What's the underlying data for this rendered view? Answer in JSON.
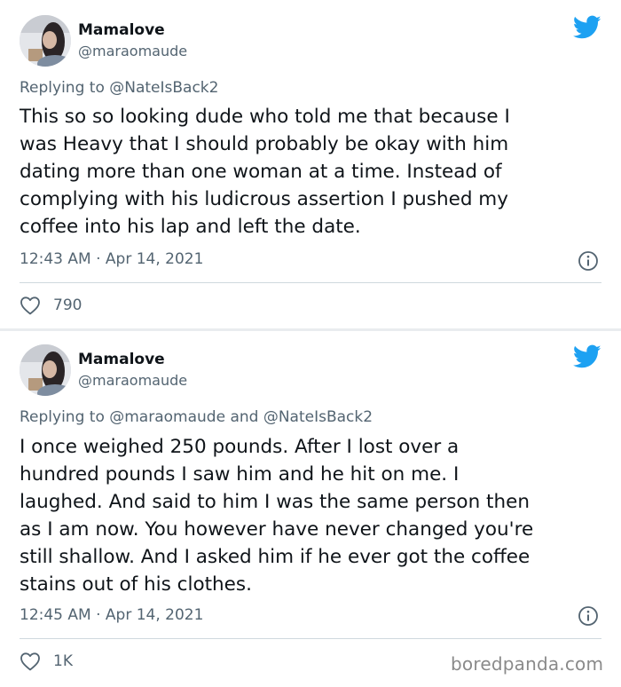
{
  "tweets": [
    {
      "author": {
        "name": "Mamalove",
        "handle": "@maraomaude"
      },
      "replying_prefix": "Replying to",
      "replying_to": "@NateIsBack2",
      "replying_joiner": "",
      "replying_to_second": "",
      "body_lines": [
        "This so so looking dude who told me that because I",
        "was Heavy that I should probably be okay with him",
        "dating more than one woman at a time. Instead of",
        "complying with his ludicrous assertion I pushed my",
        "coffee into his lap and left the date."
      ],
      "timestamp": "12:43 AM · Apr 14, 2021",
      "likes": "790"
    },
    {
      "author": {
        "name": "Mamalove",
        "handle": "@maraomaude"
      },
      "replying_prefix": "Replying to",
      "replying_to": "@maraomaude",
      "replying_joiner": "and",
      "replying_to_second": "@NateIsBack2",
      "body_lines": [
        "I once weighed 250 pounds. After I lost over a",
        "hundred pounds I saw him and he hit on me. I",
        "laughed. And said to him I was the same person then",
        "as I am now. You however have never changed you're",
        "still shallow. And I asked him if he ever got the coffee",
        "stains out of his clothes."
      ],
      "timestamp": "12:45 AM · Apr 14, 2021",
      "likes": "1K"
    }
  ],
  "watermark": "boredpanda.com",
  "colors": {
    "brand": "#1da1f2",
    "muted": "#536471",
    "text": "#0f1419"
  },
  "icons": [
    "twitter-bird-icon",
    "info-icon",
    "heart-icon"
  ]
}
